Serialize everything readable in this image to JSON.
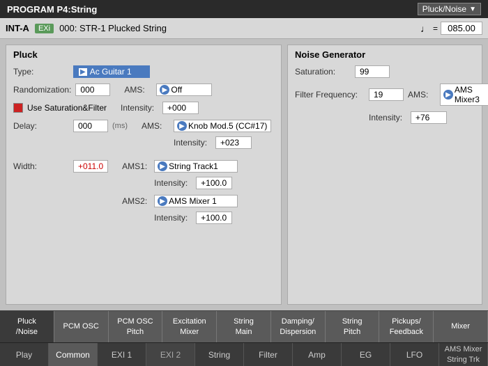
{
  "topbar": {
    "title": "PROGRAM P4:String",
    "dropdown_label": "Pluck/Noise",
    "dropdown_arrow": "▼"
  },
  "secondrow": {
    "bank": "INT-A",
    "badge": "EXi",
    "preset": "000: STR-1 Plucked String",
    "tempo_icon": "♩",
    "tempo_equals": "=",
    "tempo_value": "085.00"
  },
  "pluck": {
    "title": "Pluck",
    "type_label": "Type:",
    "type_value": "Ac Guitar 1",
    "type_arrow": "▶",
    "randomization_label": "Randomization:",
    "randomization_value": "000",
    "ams_label": "AMS:",
    "ams_off": "Off",
    "ams_arrow": "▶",
    "intensity_label": "Intensity:",
    "intensity_value": "+000",
    "checkbox_label": "Use Saturation&Filter",
    "delay_label": "Delay:",
    "delay_value": "000",
    "delay_ms": "(ms)",
    "ams2_label": "AMS:",
    "ams2_value": "Knob Mod.5  (CC#17)",
    "ams2_arrow": "▶",
    "intensity2_label": "Intensity:",
    "intensity2_value": "+023",
    "width_label": "Width:",
    "width_value": "+011.0",
    "ams3_label": "AMS1:",
    "ams3_value": "String Track1",
    "ams3_arrow": "▶",
    "intensity3_label": "Intensity:",
    "intensity3_value": "+100.0",
    "ams4_label": "AMS2:",
    "ams4_value": "AMS Mixer 1",
    "ams4_arrow": "▶",
    "intensity4_label": "Intensity:",
    "intensity4_value": "+100.0"
  },
  "noise": {
    "title": "Noise Generator",
    "saturation_label": "Saturation:",
    "saturation_value": "99",
    "filter_freq_label": "Filter Frequency:",
    "filter_freq_value": "19",
    "ams_label": "AMS:",
    "ams_value": "AMS Mixer3",
    "ams_arrow": "▶",
    "intensity_label": "Intensity:",
    "intensity_value": "+76"
  },
  "tabs_row1": [
    {
      "label": "Pluck\n/Noise",
      "active": true
    },
    {
      "label": "PCM OSC",
      "active": false
    },
    {
      "label": "PCM OSC\nPitch",
      "active": false
    },
    {
      "label": "Excitation\nMixer",
      "active": false
    },
    {
      "label": "String\nMain",
      "active": false
    },
    {
      "label": "Damping/\nDispersion",
      "active": false
    },
    {
      "label": "String\nPitch",
      "active": false
    },
    {
      "label": "Pickups/\nFeedback",
      "active": false
    },
    {
      "label": "Mixer",
      "active": false
    }
  ],
  "tabs_row2": [
    {
      "label": "Play",
      "active": false
    },
    {
      "label": "Common",
      "active": true
    },
    {
      "label": "EXI 1",
      "active": false
    },
    {
      "label": "EXI 2",
      "active": false,
      "dim": true
    },
    {
      "label": "String",
      "active": false
    },
    {
      "label": "Filter",
      "active": false
    },
    {
      "label": "Amp",
      "active": false
    },
    {
      "label": "EG",
      "active": false
    },
    {
      "label": "LFO",
      "active": false
    },
    {
      "label": "AMS Mixer\nString Trk",
      "active": false,
      "small": true
    }
  ]
}
